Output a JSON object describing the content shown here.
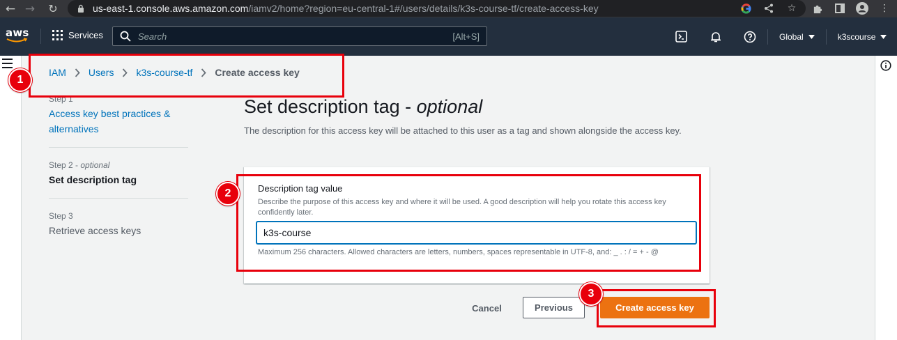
{
  "browser": {
    "url_host": "us-east-1.console.aws.amazon.com",
    "url_path": "/iamv2/home?region=eu-central-1#/users/details/k3s-course-tf/create-access-key"
  },
  "aws_nav": {
    "logo_text": "aws",
    "services_label": "Services",
    "search_placeholder": "Search",
    "search_shortcut": "[Alt+S]",
    "region_label": "Global",
    "account_label": "k3scourse"
  },
  "breadcrumb": {
    "items": [
      "IAM",
      "Users",
      "k3s-course-tf"
    ],
    "current": "Create access key"
  },
  "steps": [
    {
      "label": "Step 1",
      "title": "Access key best practices & alternatives"
    },
    {
      "label": "Step 2",
      "label_suffix": "optional",
      "title": "Set description tag"
    },
    {
      "label": "Step 3",
      "title": "Retrieve access keys"
    }
  ],
  "page": {
    "title": "Set description tag - ",
    "title_emphasis": "optional",
    "description": "The description for this access key will be attached to this user as a tag and shown alongside the access key."
  },
  "form": {
    "field_label": "Description tag value",
    "field_description": "Describe the purpose of this access key and where it will be used. A good description will help you rotate this access key confidently later.",
    "field_value": "k3s-course",
    "constraint_text": "Maximum 256 characters. Allowed characters are letters, numbers, spaces representable in UTF-8, and: _ . : / = + - @"
  },
  "actions": {
    "cancel": "Cancel",
    "previous": "Previous",
    "create": "Create access key"
  },
  "annotations": {
    "markers": [
      "1",
      "2",
      "3"
    ],
    "color": "#e8000b"
  },
  "colors": {
    "aws_nav_bg": "#232f3e",
    "link": "#0073bb",
    "primary_button": "#ec7211"
  }
}
